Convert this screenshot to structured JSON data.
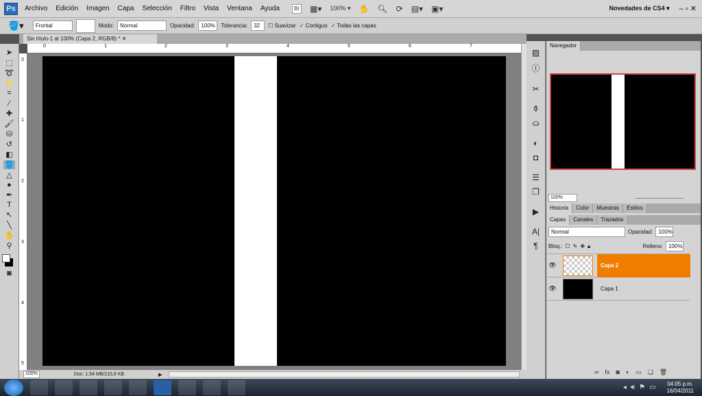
{
  "menubar": {
    "logo": "Ps",
    "items": [
      "Archivo",
      "Edición",
      "Imagen",
      "Capa",
      "Selección",
      "Filtro",
      "Vista",
      "Ventana",
      "Ayuda"
    ],
    "bridge": "Br",
    "zoom": "100%",
    "workspace": "Novedades de CS4"
  },
  "options": {
    "fill_source": "Frontal",
    "mode_label": "Modo:",
    "mode": "Normal",
    "opacity_label": "Opacidad:",
    "opacity": "100%",
    "tolerance_label": "Tolerancia:",
    "tolerance": "32",
    "antialias": "Suavizar",
    "contiguous": "Contiguo",
    "all_layers": "Todas las capas"
  },
  "document": {
    "tab_title": "Sin título-1 al 100% (Capa 2, RGB/8) *",
    "ruler_h": [
      "0",
      "1",
      "2",
      "3",
      "4",
      "5",
      "6",
      "7"
    ],
    "ruler_v": [
      "0",
      "1",
      "2",
      "3",
      "4",
      "5"
    ],
    "zoom": "100%",
    "doc_info": "Doc: 1,54 MB/215,6 KB"
  },
  "navigator": {
    "title": "Navegador",
    "zoom": "100%"
  },
  "panels": {
    "group1": [
      "Historia",
      "Color",
      "Muestras",
      "Estilos"
    ],
    "group2": [
      "Capas",
      "Canales",
      "Trazados"
    ],
    "blend": "Normal",
    "opacity_label": "Opacidad:",
    "opacity": "100%",
    "lock_label": "Bloq.:",
    "fill_label": "Relleno:",
    "fill": "100%",
    "layers": [
      {
        "name": "Capa 2"
      },
      {
        "name": "Capa 1"
      }
    ]
  },
  "taskbar": {
    "time": "04:05 p.m.",
    "date": "16/04/2011"
  },
  "colors": {
    "selected_layer": "#f07d00"
  }
}
